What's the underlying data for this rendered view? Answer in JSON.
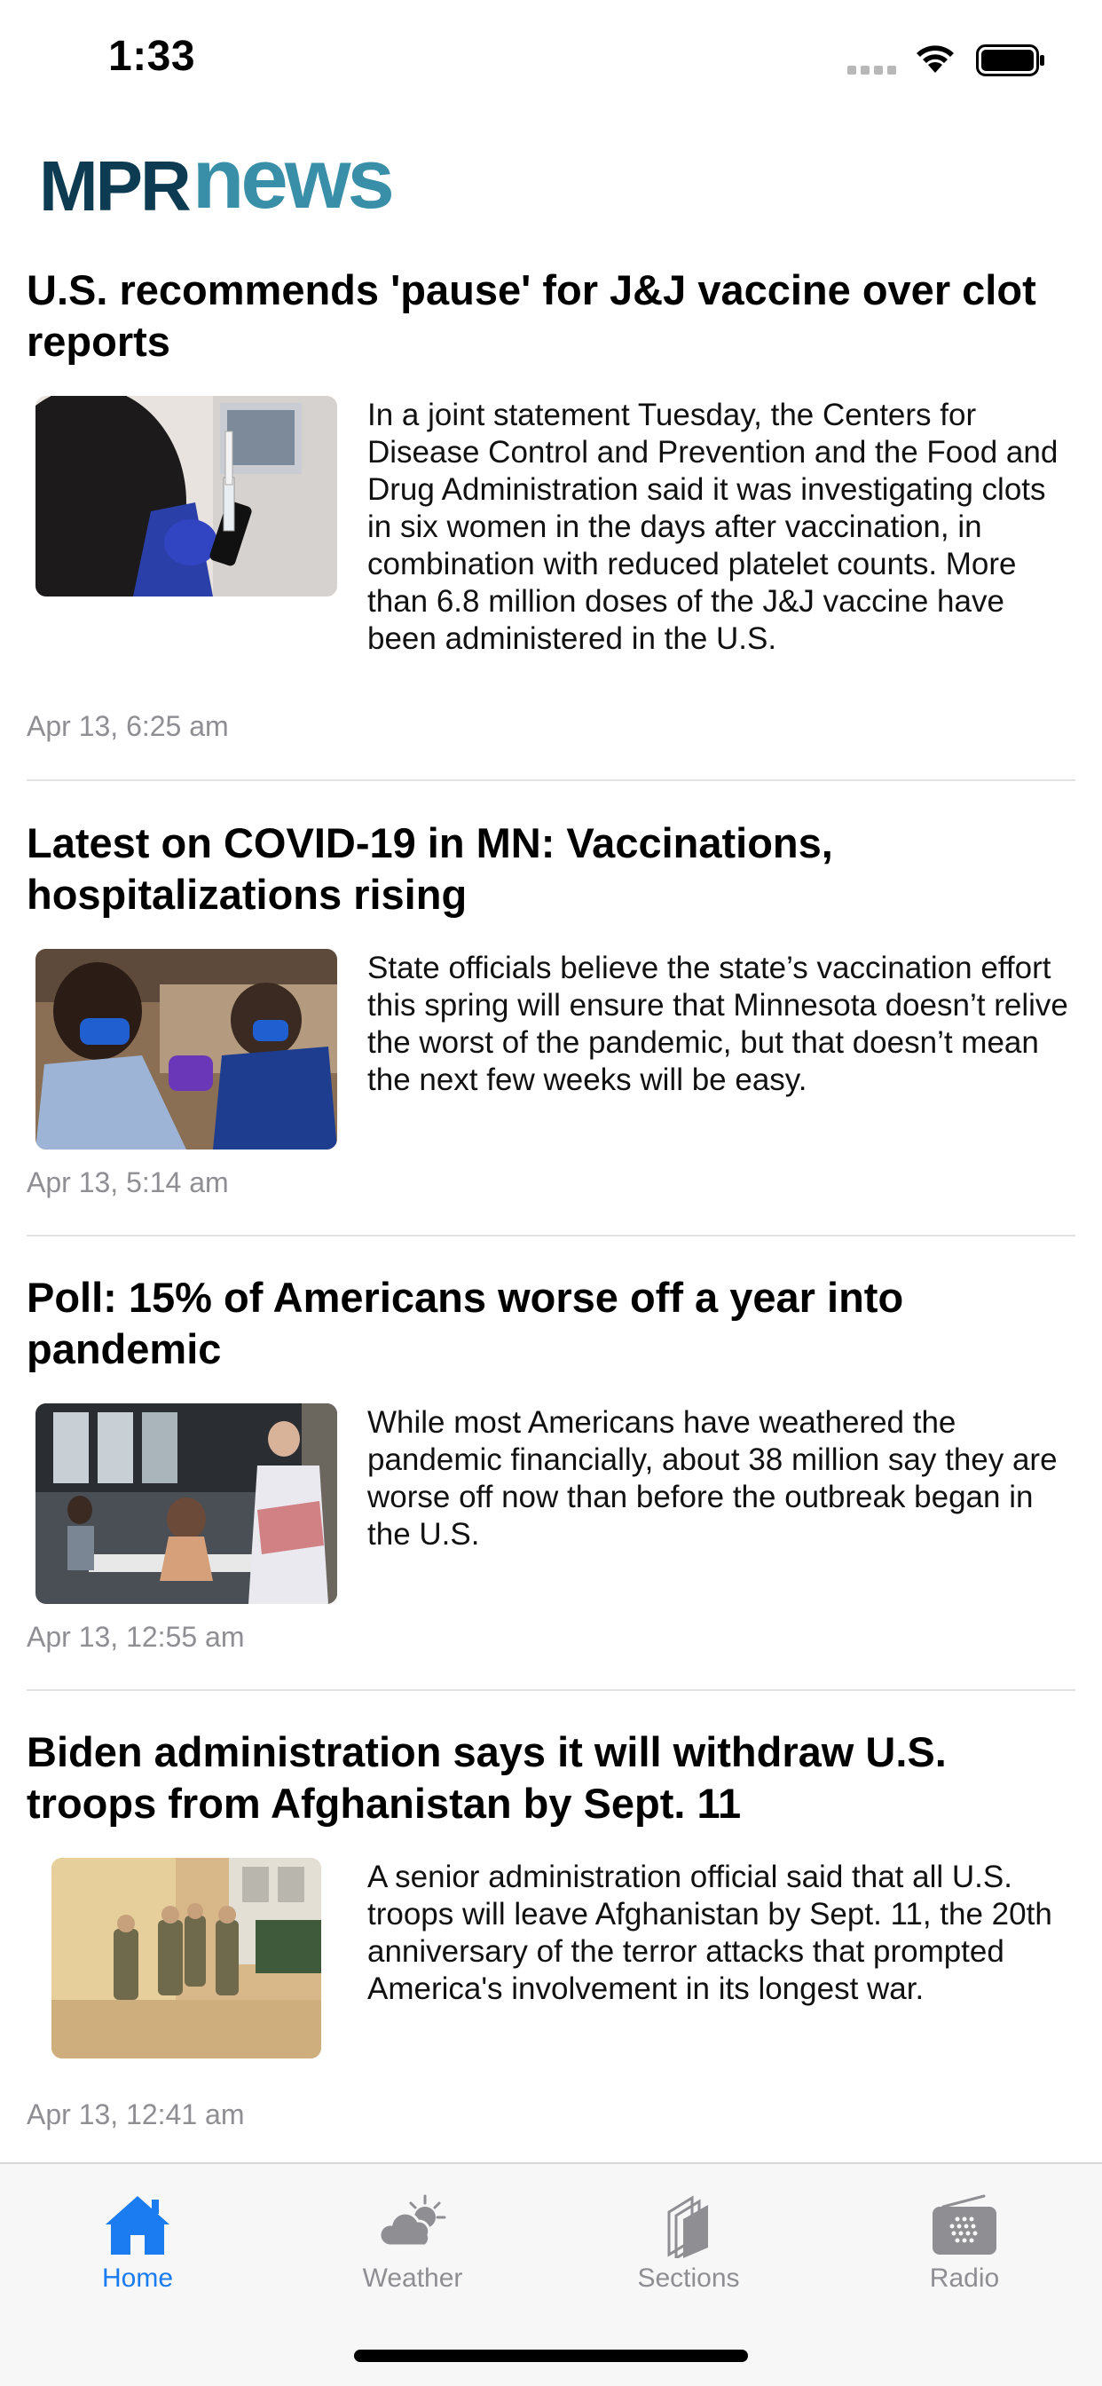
{
  "status_bar": {
    "time": "1:33"
  },
  "logo": {
    "part1": "MPR",
    "part2": "news"
  },
  "articles": [
    {
      "headline": "U.S. recommends 'pause' for J&J vaccine over clot reports",
      "summary": "In a joint statement Tuesday, the Centers for Disease Control and Prevention and the Food and Drug Administration said it was investigating clots in six women in the days after vaccination, in combination with reduced platelet counts. More than 6.8 million doses of the J&J vaccine have been administered in the U.S.",
      "date": "Apr 13, 6:25 am",
      "image": "vaccine-vial-photo"
    },
    {
      "headline": "Latest on COVID-19 in MN: Vaccinations, hospitalizations rising",
      "summary": "State officials believe the state’s vaccination effort this spring will ensure that Minnesota doesn’t relive the worst of the pandemic, but that doesn’t mean the next few weeks will be easy.",
      "date": "Apr 13, 5:14 am",
      "image": "vaccination-site-photo"
    },
    {
      "headline": "Poll: 15% of Americans worse off a year into pandemic",
      "summary": "While most Americans have weathered the pandemic financially, about 38 million say they are worse off now than before the outbreak began in the U.S.",
      "date": "Apr 13, 12:55 am",
      "image": "clinic-line-photo"
    },
    {
      "headline": "Biden administration says it will withdraw U.S. troops from Afghanistan by Sept. 11",
      "summary": "A senior administration official said that all U.S. troops will leave Afghanistan by Sept. 11, the 20th anniversary of the terror attacks that prompted America's involvement in its longest war.",
      "date": "Apr 13, 12:41 am",
      "image": "soldiers-photo"
    }
  ],
  "tab_bar": {
    "tabs": [
      {
        "label": "Home",
        "icon": "house-icon",
        "active": true
      },
      {
        "label": "Weather",
        "icon": "partly-cloudy-icon",
        "active": false
      },
      {
        "label": "Sections",
        "icon": "sections-icon",
        "active": false
      },
      {
        "label": "Radio",
        "icon": "radio-icon",
        "active": false
      }
    ]
  },
  "colors": {
    "accent": "#1a7cf0",
    "logo_dark": "#0d3b52",
    "logo_teal": "#3a8fa8",
    "meta_gray": "#8e8e93"
  }
}
